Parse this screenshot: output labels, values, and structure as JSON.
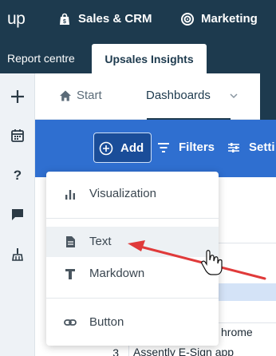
{
  "topbar": {
    "logo": "up",
    "nav": [
      {
        "label": "Sales & CRM",
        "icon": "shopping-bag-icon"
      },
      {
        "label": "Marketing",
        "icon": "target-icon"
      }
    ]
  },
  "tabs": {
    "report_centre": "Report centre",
    "upsales_insights": "Upsales Insights"
  },
  "sidebar": {
    "icons": [
      "plus-icon",
      "calendar-icon",
      "help-icon",
      "chat-icon",
      "broom-icon"
    ]
  },
  "content_tabs": {
    "start": "Start",
    "dashboards": "Dashboards"
  },
  "toolbar": {
    "add": "Add",
    "filters": "Filters",
    "settings": "Setti"
  },
  "menu": {
    "items": [
      {
        "label": "Visualization",
        "icon": "bar-chart-icon"
      },
      {
        "label": "Text",
        "icon": "document-icon"
      },
      {
        "label": "Markdown",
        "icon": "text-t-icon"
      },
      {
        "label": "Button",
        "icon": "link-icon"
      }
    ],
    "active_item": "Text"
  },
  "background_table": {
    "row_partial": "hrome",
    "row_index": "3",
    "row_text": "Assently E-Sign app"
  },
  "colors": {
    "navy": "#1d3a4e",
    "toolbar_blue": "#2f6fd0",
    "add_button": "#1a4d99",
    "annotation_arrow": "#e03a3a"
  }
}
